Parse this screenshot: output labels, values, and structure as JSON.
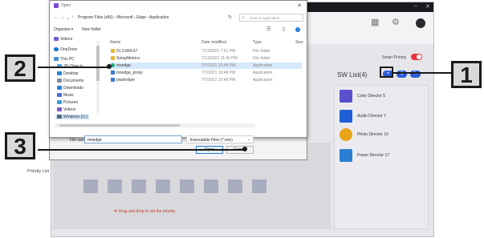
{
  "app": {
    "minimize": "–",
    "close": "✕",
    "top_icons": [
      "grid-icon",
      "gear-icon",
      "user-icon"
    ],
    "smart_priority_label": "Smart Priority",
    "sw_list_title": "SW List(4)",
    "sw_buttons": [
      "+",
      "⊖",
      "✎"
    ],
    "sw_items": [
      {
        "name": "Color Director 5",
        "color": "#5a4fcf"
      },
      {
        "name": "Audio Director 7",
        "color": "#1f5fd6"
      },
      {
        "name": "Photo Director 10",
        "color": "#e8a317"
      },
      {
        "name": "Power Director 17",
        "color": "#2a7fd4"
      }
    ],
    "priority_title": "Priority List",
    "drag_hint": "Drag and drop to set the priority."
  },
  "dialog": {
    "title": "Open",
    "close": "✕",
    "breadcrumb": "Program Files (x86)  ›  Microsoft  ›  Edge  ›  Application",
    "search_placeholder": "Search Application",
    "organize": "Organize ▾",
    "new_folder": "New folder",
    "nav_items": [
      {
        "label": "Videos",
        "color": "#7a5bc9"
      },
      {
        "label": "OneDrive",
        "color": "#1a73d9"
      },
      {
        "label": "This PC",
        "color": "#3d8fd6"
      },
      {
        "label": "3D Objects",
        "color": "#4aa3df"
      },
      {
        "label": "Desktop",
        "color": "#2a7fd4"
      },
      {
        "label": "Documents",
        "color": "#7b8aa0"
      },
      {
        "label": "Downloads",
        "color": "#2a7fd4"
      },
      {
        "label": "Music",
        "color": "#4a6fd0"
      },
      {
        "label": "Pictures",
        "color": "#3aa0d8"
      },
      {
        "label": "Videos",
        "color": "#7a5bc9"
      },
      {
        "label": "Windows (C:)",
        "color": "#5c6b7a"
      }
    ],
    "columns": [
      "Name",
      "Date modified",
      "Type",
      "Size"
    ],
    "files": [
      {
        "name": "91.0.864.67",
        "date": "7/13/2021 7:51 PM",
        "type": "File folder",
        "color": "#e8b73a"
      },
      {
        "name": "SetupMetrics",
        "date": "7/13/2021 11:41 PM",
        "type": "File folder",
        "color": "#e8b73a"
      },
      {
        "name": "msedge",
        "date": "7/7/2021 10:48 PM",
        "type": "Application",
        "color": "#1fa874"
      },
      {
        "name": "msedge_proxy",
        "date": "7/7/2021 10:48 PM",
        "type": "Application",
        "color": "#3b7bd6"
      },
      {
        "name": "pwahelper",
        "date": "7/7/2021 10:48 PM",
        "type": "Application",
        "color": "#3b7bd6"
      }
    ],
    "file_name_label": "File name:",
    "file_name_value": "msedge",
    "file_type": "Executable Files (*.exe)",
    "open": "Open",
    "cancel": "Cancel"
  },
  "callouts": [
    "1",
    "2",
    "3"
  ]
}
